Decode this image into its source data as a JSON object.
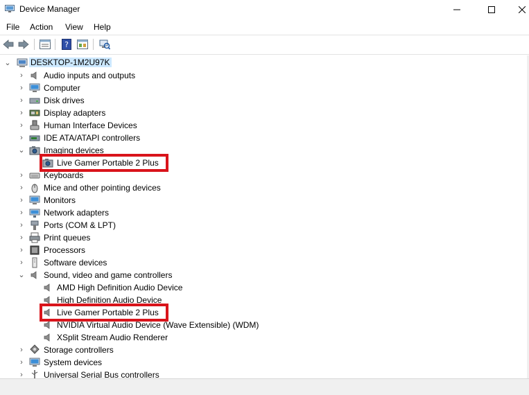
{
  "window": {
    "title": "Device Manager"
  },
  "menu": [
    "File",
    "Action",
    "View",
    "Help"
  ],
  "colors": {
    "highlight": "#d9141b",
    "selection": "#cce8ff"
  },
  "tree": {
    "root": "DESKTOP-1M2U97K",
    "categories": [
      {
        "label": "Audio inputs and outputs",
        "icon": "speaker-icon",
        "expanded": false
      },
      {
        "label": "Computer",
        "icon": "monitor-icon",
        "expanded": false
      },
      {
        "label": "Disk drives",
        "icon": "disk-drive-icon",
        "expanded": false
      },
      {
        "label": "Display adapters",
        "icon": "display-adapter-icon",
        "expanded": false
      },
      {
        "label": "Human Interface Devices",
        "icon": "hid-icon",
        "expanded": false
      },
      {
        "label": "IDE ATA/ATAPI controllers",
        "icon": "ide-controller-icon",
        "expanded": false
      },
      {
        "label": "Imaging devices",
        "icon": "camera-icon",
        "expanded": true,
        "children": [
          {
            "label": "Live Gamer Portable 2 Plus",
            "icon": "camera-icon",
            "highlighted": true
          }
        ]
      },
      {
        "label": "Keyboards",
        "icon": "keyboard-icon",
        "expanded": false
      },
      {
        "label": "Mice and other pointing devices",
        "icon": "mouse-icon",
        "expanded": false
      },
      {
        "label": "Monitors",
        "icon": "monitor-icon",
        "expanded": false
      },
      {
        "label": "Network adapters",
        "icon": "network-adapter-icon",
        "expanded": false
      },
      {
        "label": "Ports (COM & LPT)",
        "icon": "port-icon",
        "expanded": false
      },
      {
        "label": "Print queues",
        "icon": "printer-icon",
        "expanded": false
      },
      {
        "label": "Processors",
        "icon": "processor-icon",
        "expanded": false
      },
      {
        "label": "Software devices",
        "icon": "software-device-icon",
        "expanded": false
      },
      {
        "label": "Sound, video and game controllers",
        "icon": "speaker-icon",
        "expanded": true,
        "children": [
          {
            "label": "AMD High Definition Audio Device",
            "icon": "speaker-icon",
            "highlighted": false
          },
          {
            "label": "High Definition Audio Device",
            "icon": "speaker-icon",
            "highlighted": false
          },
          {
            "label": "Live Gamer Portable 2 Plus",
            "icon": "speaker-icon",
            "highlighted": true
          },
          {
            "label": "NVIDIA Virtual Audio Device (Wave Extensible) (WDM)",
            "icon": "speaker-icon",
            "highlighted": false
          },
          {
            "label": "XSplit  Stream  Audio  Renderer",
            "icon": "speaker-icon",
            "highlighted": false
          }
        ]
      },
      {
        "label": "Storage controllers",
        "icon": "storage-controller-icon",
        "expanded": false
      },
      {
        "label": "System devices",
        "icon": "monitor-icon",
        "expanded": false
      },
      {
        "label": "Universal Serial Bus controllers",
        "icon": "usb-icon",
        "expanded": false
      }
    ]
  }
}
